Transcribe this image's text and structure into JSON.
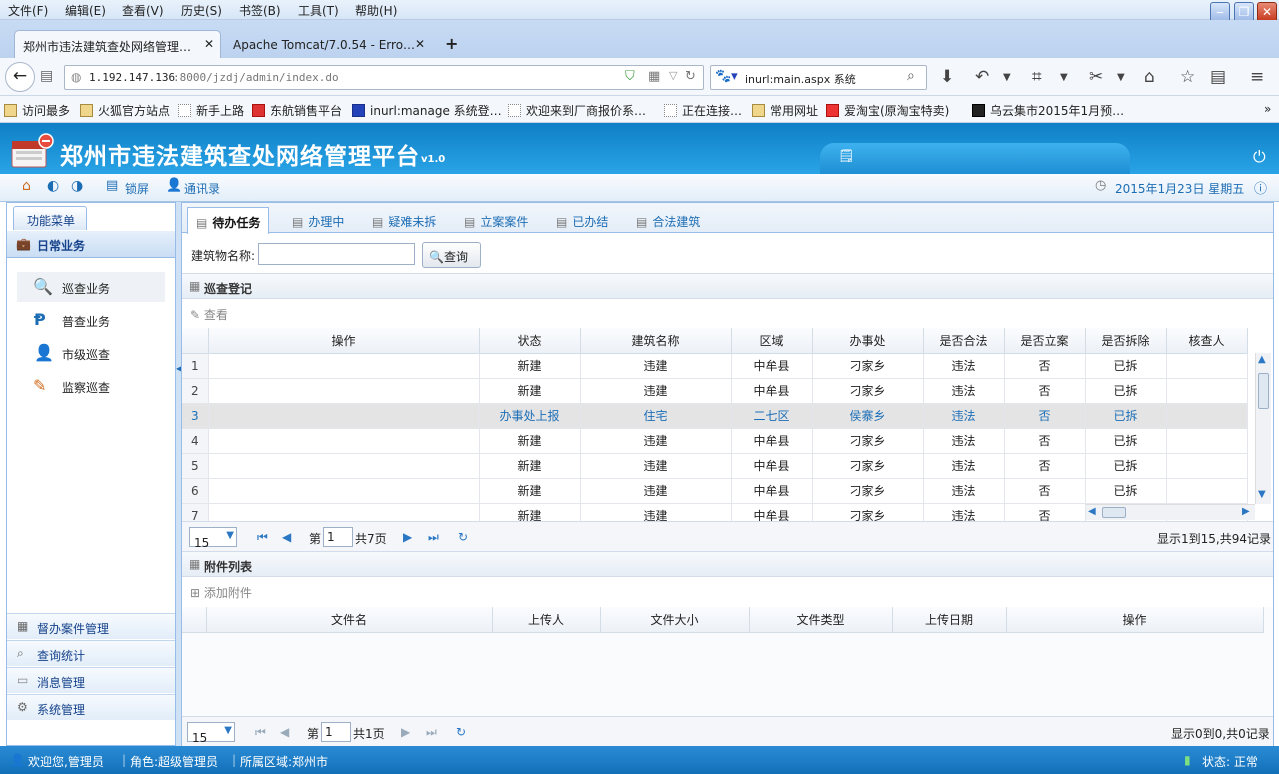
{
  "browser_menu": [
    "文件(F)",
    "编辑(E)",
    "查看(V)",
    "历史(S)",
    "书签(B)",
    "工具(T)",
    "帮助(H)"
  ],
  "browser_tabs": [
    {
      "label": "郑州市违法建筑查处网络管理…"
    },
    {
      "label": "Apache Tomcat/7.0.54 - Erro…"
    }
  ],
  "address": {
    "host": "1.192.147.136",
    "rest": ":8000/jzdj/admin/index.do"
  },
  "search": {
    "value": "inurl:main.aspx 系统"
  },
  "bookmarks": [
    "访问最多",
    "火狐官方站点",
    "新手上路",
    "东航销售平台",
    "inurl:manage 系统登…",
    "欢迎来到厂商报价系…",
    "正在连接…",
    "常用网址",
    "爱淘宝(原淘宝特卖)",
    "乌云集市2015年1月预…"
  ],
  "app": {
    "title": "郑州市违法建筑查处网络管理平台",
    "version": "v1.0"
  },
  "toolbar": {
    "lock": "锁屏",
    "contacts": "通讯录",
    "date": "2015年1月23日 星期五"
  },
  "sidebar": {
    "tab": "功能菜单",
    "section": "日常业务",
    "items": [
      "巡查业务",
      "普查业务",
      "市级巡查",
      "监察巡查"
    ],
    "bottom": [
      "督办案件管理",
      "查询统计",
      "消息管理",
      "系统管理"
    ]
  },
  "main_tabs": [
    "待办任务",
    "办理中",
    "疑难未拆",
    "立案案件",
    "已办结",
    "合法建筑"
  ],
  "search_form": {
    "label": "建筑物名称:",
    "value": "",
    "button": "查询"
  },
  "panel1": {
    "title": "巡查登记",
    "action": "查看",
    "columns": [
      "操作",
      "状态",
      "建筑名称",
      "区域",
      "办事处",
      "是否合法",
      "是否立案",
      "是否拆除",
      "核查人"
    ],
    "rows": [
      {
        "n": "1",
        "op": "",
        "status": "新建",
        "name": "违建",
        "area": "中牟县",
        "office": "刁家乡",
        "legal": "违法",
        "filed": "否",
        "demolished": "已拆",
        "checker": ""
      },
      {
        "n": "2",
        "op": "",
        "status": "新建",
        "name": "违建",
        "area": "中牟县",
        "office": "刁家乡",
        "legal": "违法",
        "filed": "否",
        "demolished": "已拆",
        "checker": ""
      },
      {
        "n": "3",
        "op": "",
        "status": "办事处上报",
        "name": "住宅",
        "area": "二七区",
        "office": "侯寨乡",
        "legal": "违法",
        "filed": "否",
        "demolished": "已拆",
        "checker": ""
      },
      {
        "n": "4",
        "op": "",
        "status": "新建",
        "name": "违建",
        "area": "中牟县",
        "office": "刁家乡",
        "legal": "违法",
        "filed": "否",
        "demolished": "已拆",
        "checker": ""
      },
      {
        "n": "5",
        "op": "",
        "status": "新建",
        "name": "违建",
        "area": "中牟县",
        "office": "刁家乡",
        "legal": "违法",
        "filed": "否",
        "demolished": "已拆",
        "checker": ""
      },
      {
        "n": "6",
        "op": "",
        "status": "新建",
        "name": "违建",
        "area": "中牟县",
        "office": "刁家乡",
        "legal": "违法",
        "filed": "否",
        "demolished": "已拆",
        "checker": ""
      },
      {
        "n": "7",
        "op": "",
        "status": "新建",
        "name": "违建",
        "area": "中牟县",
        "office": "刁家乡",
        "legal": "违法",
        "filed": "否",
        "demolished": ""
      }
    ],
    "pager": {
      "page_size": "15",
      "page_label": "第",
      "page": "1",
      "total": "共7页",
      "info": "显示1到15,共94记录"
    }
  },
  "panel2": {
    "title": "附件列表",
    "action": "添加附件",
    "columns": [
      "文件名",
      "上传人",
      "文件大小",
      "文件类型",
      "上传日期",
      "操作"
    ],
    "pager": {
      "page_size": "15",
      "page_label": "第",
      "page": "1",
      "total": "共1页",
      "info": "显示0到0,共0记录"
    }
  },
  "statusbar": {
    "welcome": "欢迎您,管理员",
    "role": "角色:超级管理员",
    "region": "所属区域:郑州市",
    "state": "状态: 正常"
  },
  "colors": {
    "header": "#1a8fd6",
    "accent": "#1d6db4",
    "border": "#99bbe8"
  }
}
